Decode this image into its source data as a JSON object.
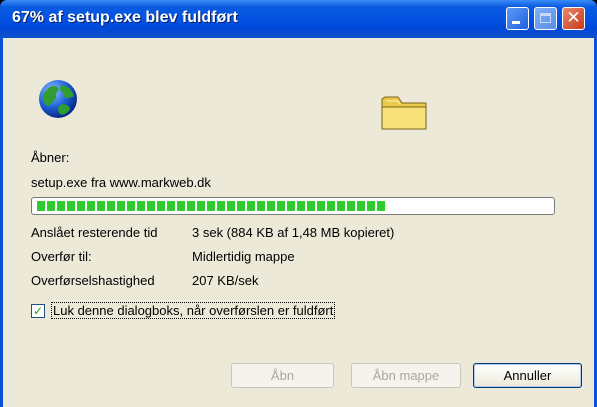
{
  "window": {
    "title": "67% af setup.exe blev fuldført",
    "controls": {
      "minimize": "minimize",
      "maximize": "maximize",
      "close": "✕"
    }
  },
  "icons": {
    "source": "globe-icon",
    "destination": "folder-icon"
  },
  "status": {
    "opening_label": "Åbner:",
    "source_text": "setup.exe fra www.markweb.dk",
    "progress_percent": 67,
    "estimated_label": "Anslået resterende tid",
    "estimated_value": "3 sek (884 KB af 1,48 MB kopieret)",
    "transfer_to_label": "Overfør til:",
    "transfer_to_value": "Midlertidig mappe",
    "speed_label": "Overførselshastighed",
    "speed_value": "207 KB/sek"
  },
  "options": {
    "close_on_complete_label": "Luk denne dialogboks, når overførslen er fuldført",
    "close_on_complete_checked": true
  },
  "buttons": {
    "open": "Åbn",
    "open_folder": "Åbn mappe",
    "cancel": "Annuller"
  }
}
